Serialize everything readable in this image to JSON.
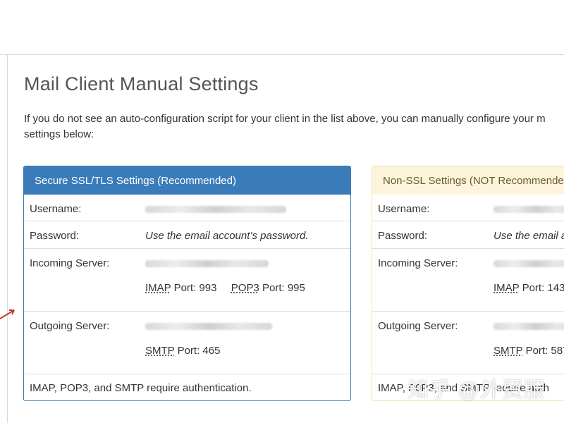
{
  "page": {
    "title": "Mail Client Manual Settings",
    "intro_line1": "If you do not see an auto-configuration script for your client in the list above, you can manually configure your m",
    "intro_line2": "settings below:"
  },
  "secure": {
    "header": "Secure SSL/TLS Settings (Recommended)",
    "username_label": "Username:",
    "password_label": "Password:",
    "password_value": "Use the email account’s password.",
    "incoming_label": "Incoming Server:",
    "imap_abbr": "IMAP",
    "imap_port": "Port: 993",
    "pop3_abbr": "POP3",
    "pop3_port": "Port: 995",
    "outgoing_label": "Outgoing Server:",
    "smtp_abbr": "SMTP",
    "smtp_port": "Port: 465",
    "auth_note": "IMAP, POP3, and SMTP require authentication."
  },
  "nonssl": {
    "header": "Non-SSL Settings (NOT Recommende",
    "username_label": "Username:",
    "password_label": "Password:",
    "password_value": "Use the email a",
    "incoming_label": "Incoming Server:",
    "imap_abbr": "IMAP",
    "imap_port": "Port: 143",
    "outgoing_label": "Outgoing Server:",
    "smtp_abbr": "SMTP",
    "smtp_port": "Port: 587",
    "auth_note": "IMAP, P0P3, and SMTP require auth"
  },
  "watermark": "知乎 @外贸服",
  "colors": {
    "secure_header_bg": "#3a7cba",
    "nonssl_header_bg": "#fcf5dc",
    "arrow": "#c0392b"
  }
}
